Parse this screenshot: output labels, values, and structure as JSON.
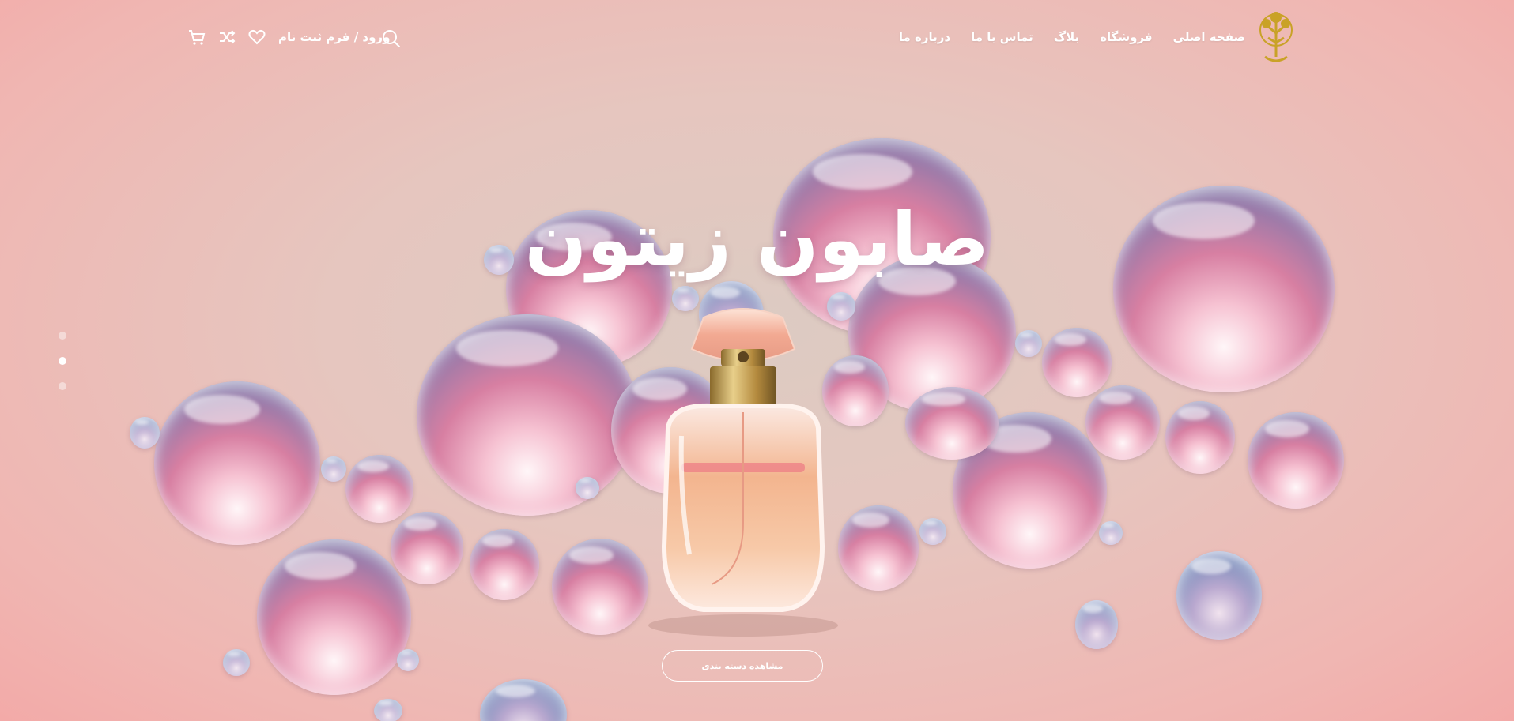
{
  "header": {
    "logo_icon": "olive-tree-logo-icon",
    "nav": [
      {
        "label": "صفحه اصلی"
      },
      {
        "label": "فروشگاه"
      },
      {
        "label": "بلاگ"
      },
      {
        "label": "تماس با ما"
      },
      {
        "label": "درباره ما"
      }
    ],
    "login_label": "ورود / فرم ثبت نام",
    "icons": [
      "search-icon",
      "heart-icon",
      "shuffle-icon",
      "cart-icon"
    ]
  },
  "hero": {
    "title": "صابون زیتون",
    "cta_label": "مشاهده دسته بندی",
    "slides_total": 3,
    "active_slide": 2
  },
  "colors": {
    "background": "#e6c6bf",
    "edge_pink": "#f3aaa8",
    "text": "#ffffff",
    "logo_gold": "#c9a227"
  }
}
